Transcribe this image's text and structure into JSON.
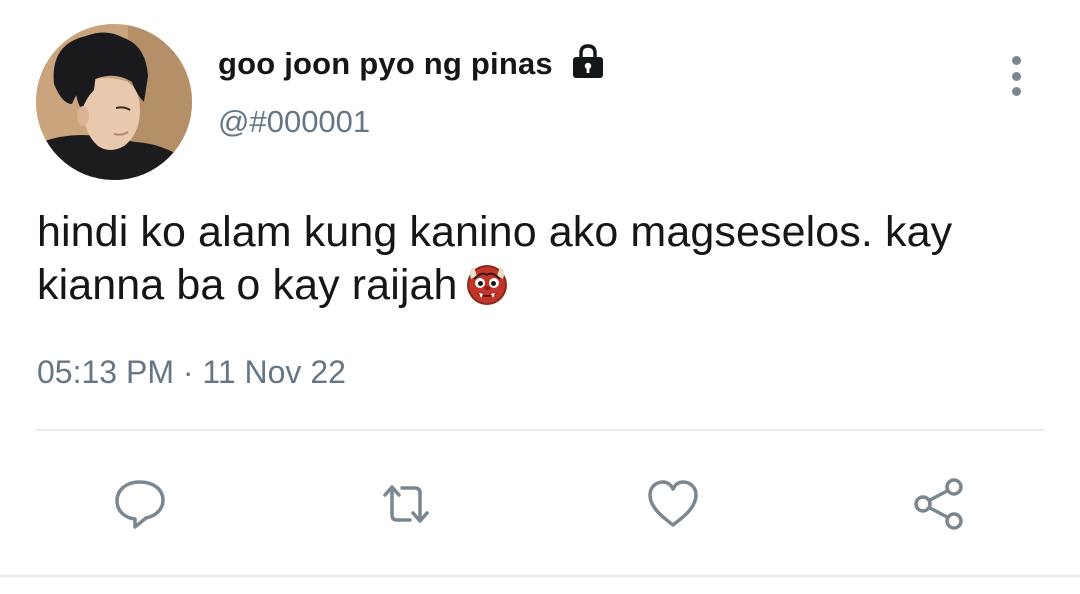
{
  "tweet": {
    "display_name": "goo joon pyo ng pinas",
    "handle": "@#000001",
    "text": "hindi ko alam kung kanino ako magseselos. kay kianna ba o kay raijah",
    "emoji": "ogre-emoji",
    "timestamp": "05:13 PM · 11 Nov 22",
    "protected": true
  },
  "actions": {
    "reply": "reply-icon",
    "retweet": "retweet-icon",
    "like": "heart-icon",
    "share": "share-icon"
  },
  "colors": {
    "text": "#14171a",
    "secondary_text": "#657786",
    "icon": "#7a8791",
    "divider": "#e6ecf0",
    "background": "#ffffff"
  }
}
